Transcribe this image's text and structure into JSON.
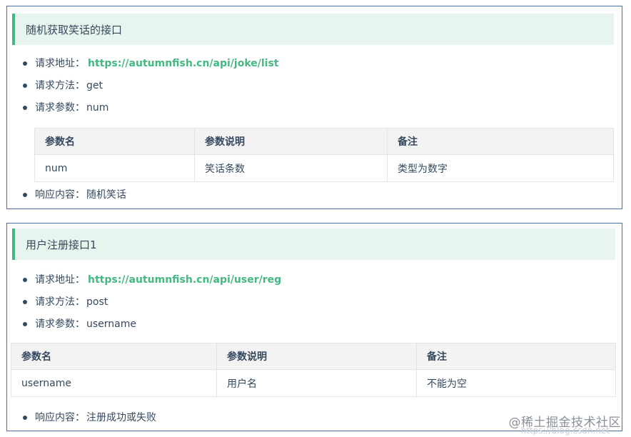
{
  "sections": [
    {
      "title": "随机获取笑话的接口",
      "request_url_label": "请求地址：",
      "request_url": "https://autumnfish.cn/api/joke/list",
      "method_label": "请求方法：",
      "method": "get",
      "params_label": "请求参数：",
      "params": "num",
      "table": {
        "headers": [
          "参数名",
          "参数说明",
          "备注"
        ],
        "rows": [
          [
            "num",
            "笑话条数",
            "类型为数字"
          ]
        ]
      },
      "response_label": "响应内容：",
      "response": "随机笑话"
    },
    {
      "title": "用户注册接口1",
      "request_url_label": "请求地址：",
      "request_url": "https://autumnfish.cn/api/user/reg",
      "method_label": "请求方法：",
      "method": "post",
      "params_label": "请求参数：",
      "params": "username",
      "table": {
        "headers": [
          "参数名",
          "参数说明",
          "备注"
        ],
        "rows": [
          [
            "username",
            "用户名",
            "不能为空"
          ]
        ]
      },
      "response_label": "响应内容：",
      "response": "注册成功或失败"
    }
  ],
  "watermark": "@稀土掘金技术社区",
  "watermark_faint": "https://blog.csdn.net"
}
